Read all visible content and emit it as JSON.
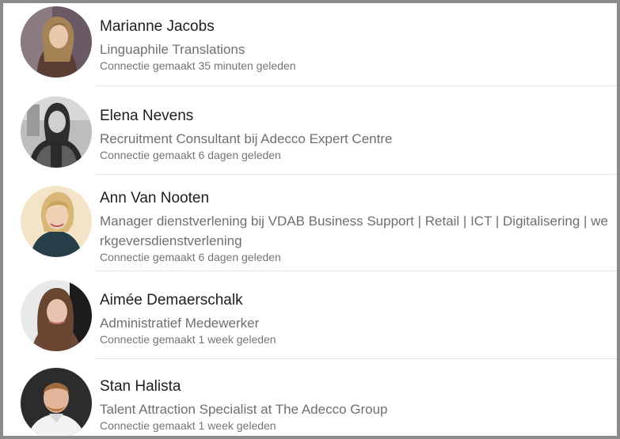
{
  "connections": [
    {
      "name": "Marianne Jacobs",
      "headline": "Linguaphile Translations",
      "meta": "Connectie gemaakt 35 minuten geleden"
    },
    {
      "name": "Elena Nevens",
      "headline": "Recruitment Consultant bij Adecco Expert Centre",
      "meta": "Connectie gemaakt 6 dagen geleden"
    },
    {
      "name": "Ann Van Nooten",
      "headline": "Manager dienstverlening bij VDAB Business Support | Retail | ICT | Digitalisering | werkgeversdienstverlening",
      "meta": "Connectie gemaakt 6 dagen geleden"
    },
    {
      "name": "Aimée Demaerschalk",
      "headline": "Administratief Medewerker",
      "meta": "Connectie gemaakt 1 week geleden"
    },
    {
      "name": "Stan Halista",
      "headline": "Talent Attraction Specialist at The Adecco Group",
      "meta": "Connectie gemaakt 1 week geleden"
    }
  ],
  "colors": {
    "frame_border": "#8b8b8b",
    "name_text": "#1d1d1d",
    "headline_text": "#6f6f6f",
    "meta_text": "#747474",
    "divider": "#e3e3e3"
  }
}
